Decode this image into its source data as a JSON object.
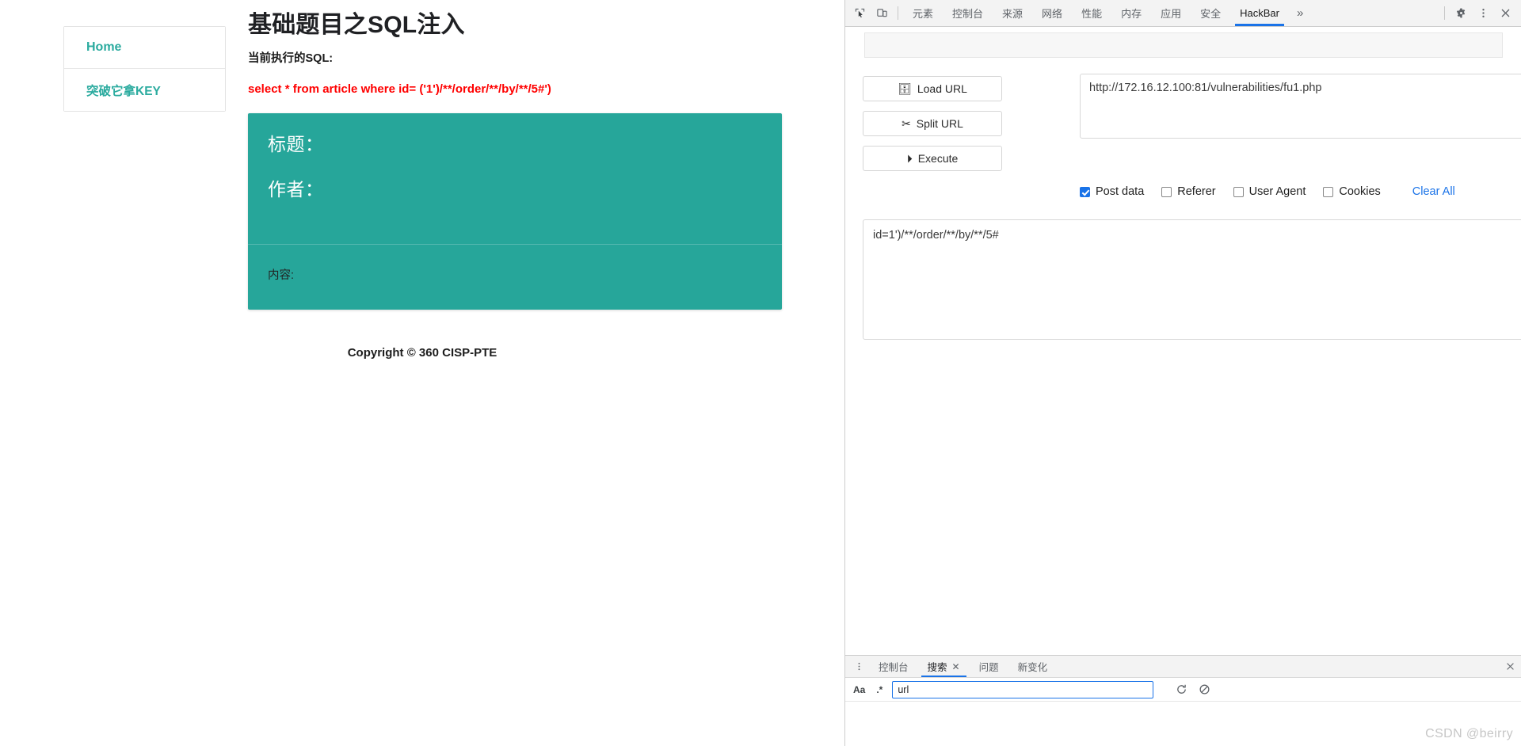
{
  "page": {
    "title": "基础题目之SQL注入",
    "sql_label": "当前执行的SQL:",
    "sql_query": "select * from article where id= ('1')/**/order/**/by/**/5#')",
    "nav": [
      {
        "label": "Home"
      },
      {
        "label": "突破它拿KEY"
      }
    ],
    "article": {
      "title_label": "标题：",
      "author_label": "作者：",
      "content_label": "内容:"
    },
    "footer": "Copyright © 360 CISP-PTE"
  },
  "devtools": {
    "toolbar": {
      "inspect_icon": "inspect-cursor-icon",
      "device_icon": "device-toolbar-icon",
      "tabs": [
        {
          "label": "元素",
          "active": false
        },
        {
          "label": "控制台",
          "active": false
        },
        {
          "label": "来源",
          "active": false
        },
        {
          "label": "网络",
          "active": false
        },
        {
          "label": "性能",
          "active": false
        },
        {
          "label": "内存",
          "active": false
        },
        {
          "label": "应用",
          "active": false
        },
        {
          "label": "安全",
          "active": false
        },
        {
          "label": "HackBar",
          "active": true
        }
      ],
      "more_label": "»",
      "settings_icon": "gear-icon",
      "menu_icon": "kebab-menu-icon",
      "close_icon": "close-icon"
    },
    "hackbar": {
      "buttons": [
        {
          "label": "Load URL",
          "icon": "load-url-icon"
        },
        {
          "label": "Split URL",
          "icon": "split-url-icon"
        },
        {
          "label": "Execute",
          "icon": "execute-icon"
        }
      ],
      "url_value": "http://172.16.12.100:81/vulnerabilities/fu1.php",
      "options": [
        {
          "label": "Post data",
          "checked": true
        },
        {
          "label": "Referer",
          "checked": false
        },
        {
          "label": "User Agent",
          "checked": false
        },
        {
          "label": "Cookies",
          "checked": false
        }
      ],
      "clear_all_label": "Clear All",
      "post_data_value": "id=1')/**/order/**/by/**/5#"
    },
    "drawer": {
      "kebab_icon": "kebab-menu-icon",
      "tabs": [
        {
          "label": "控制台",
          "active": false,
          "closable": false
        },
        {
          "label": "搜索",
          "active": true,
          "closable": true
        },
        {
          "label": "问题",
          "active": false,
          "closable": false
        },
        {
          "label": "新变化",
          "active": false,
          "closable": false
        }
      ],
      "close_icon": "close-icon",
      "search": {
        "match_case_label": "Aa",
        "regex_label": ".*",
        "value": "url",
        "refresh_icon": "refresh-icon",
        "cancel-icon": "cancel-icon"
      }
    }
  },
  "watermark": "CSDN @beirry",
  "colors": {
    "teal": "#26a69a",
    "sql_red": "#ff0000",
    "link_blue": "#1a73e8",
    "nav_teal": "#2bab9f"
  }
}
